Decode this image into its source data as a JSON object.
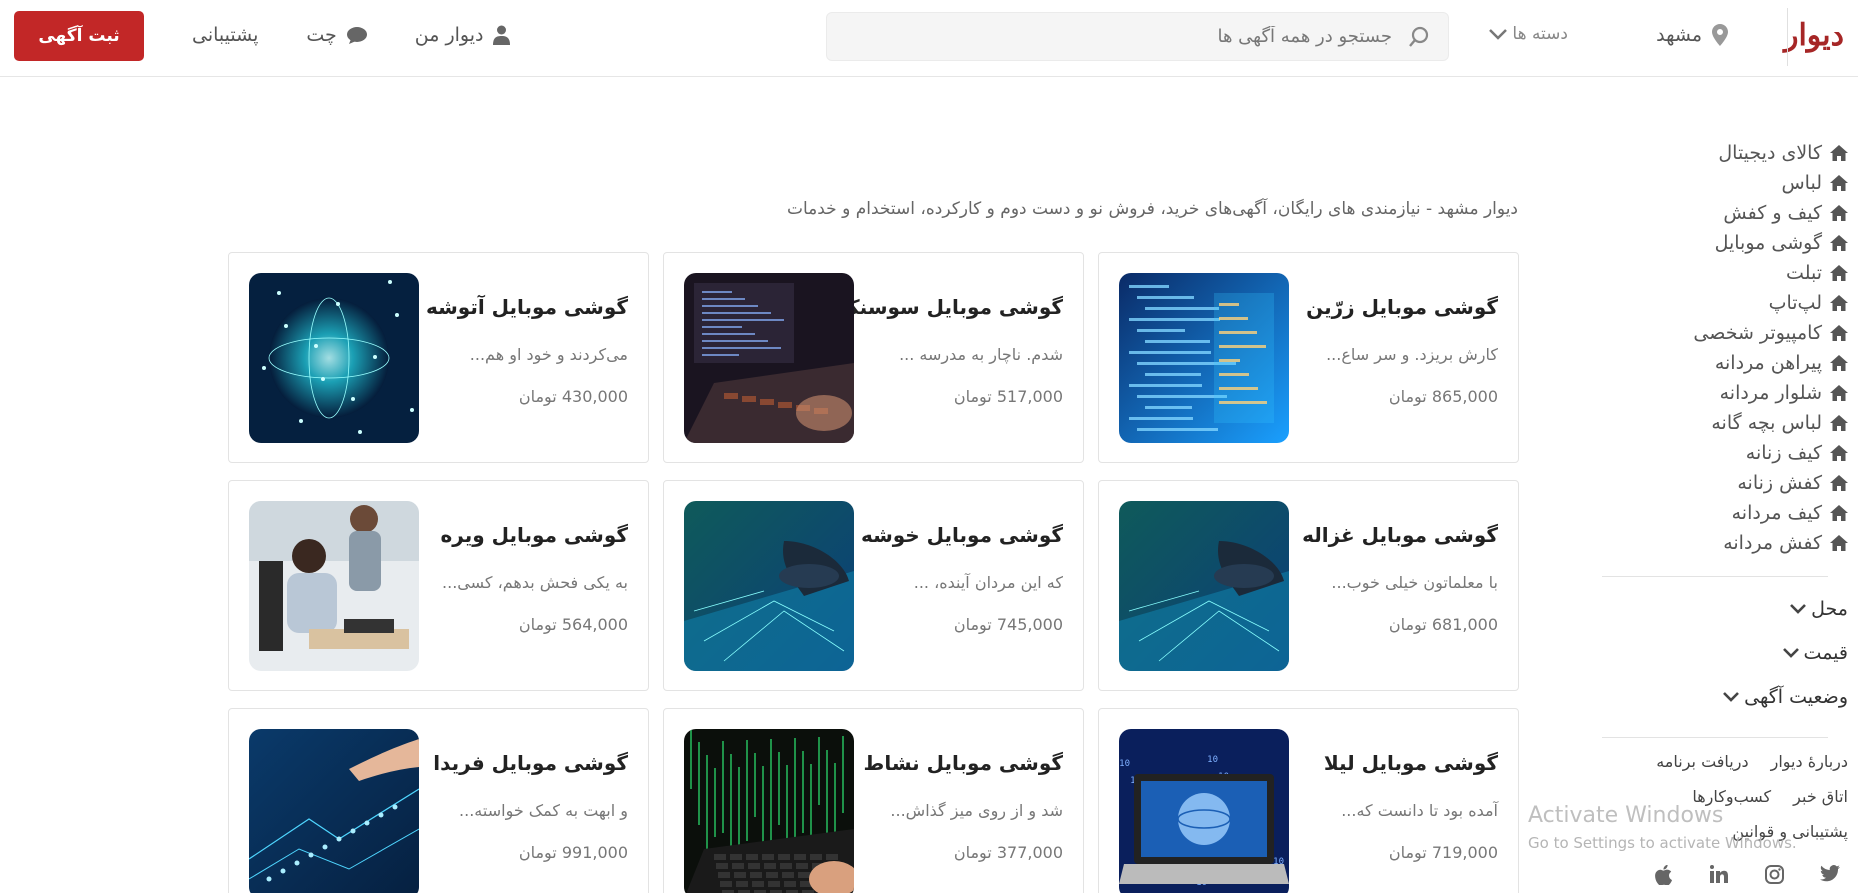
{
  "header": {
    "logo": "دیوار",
    "city": "مشهد",
    "categories_label": "دسته ها",
    "search_placeholder": "جستجو در همه آگهی ها",
    "nav": {
      "my_divar": "دیوار من",
      "chat": "چت",
      "support": "پشتیبانی"
    },
    "post_button": "ثبت آگهی"
  },
  "sidebar": {
    "categories": [
      "کالای دیجیتال",
      "لباس",
      "کیف و کفش",
      "گوشی موبایل",
      "تبلت",
      "لپ‌تاپ",
      "کامپیوتر شخصی",
      "پیراهن مردانه",
      "شلوار مردانه",
      "لباس بچه گانه",
      "کیف زنانه",
      "کفش زنانه",
      "کیف مردانه",
      "کفش مردانه"
    ],
    "filters": [
      "محل",
      "قیمت",
      "وضعیت آگهی"
    ],
    "footer_links": [
      "دربارهٔ دیوار",
      "دریافت برنامه",
      "اتاق خبر",
      "کسب‌وکارها",
      "پشتیبانی و قوانین"
    ],
    "social_icons": [
      "twitter-icon",
      "instagram-icon",
      "linkedin-icon",
      "apple-icon"
    ]
  },
  "main": {
    "description": "دیوار مشهد - نیازمندی های رایگان، آگهی‌های خرید، فروش نو و دست دوم و کارکرده، استخدام و خدمات",
    "listings": [
      {
        "title": "گوشی موبایل زرّین",
        "desc": "کارش بریزد. و سر ساع...",
        "price": "865,000 تومان",
        "image": "code-screen-blue"
      },
      {
        "title": "گوشی موبایل سوسنک",
        "desc": "شدم. ناچار به مدرسه ...",
        "price": "517,000 تومان",
        "image": "laptop-code-dark"
      },
      {
        "title": "گوشی موبایل آتوشه",
        "desc": "می‌کردند و خود او هم...",
        "price": "430,000 تومان",
        "image": "digital-globe-teal"
      },
      {
        "title": "گوشی موبایل غزاله",
        "desc": "با معلماتون خیلی خوب...",
        "price": "681,000 تومان",
        "image": "hand-laptop-network"
      },
      {
        "title": "گوشی موبایل خوشه",
        "desc": "که این مردان آینده، ...",
        "price": "745,000 تومان",
        "image": "hand-laptop-network"
      },
      {
        "title": "گوشی موبایل ویره",
        "desc": "به یکی فحش بدهم، کسی...",
        "price": "564,000 تومان",
        "image": "office-people"
      },
      {
        "title": "گوشی موبایل لیلا",
        "desc": "آمده بود تا دانست که...",
        "price": "719,000 تومان",
        "image": "laptop-globe-binary"
      },
      {
        "title": "گوشی موبایل نشاط",
        "desc": "شد و از روی میز گذاش...",
        "price": "377,000 تومان",
        "image": "laptop-matrix-green"
      },
      {
        "title": "گوشی موبایل فریدا",
        "desc": "و ابهت به کمک خواسته...",
        "price": "991,000 تومان",
        "image": "hand-circuit-blue"
      }
    ]
  },
  "watermark": {
    "line1": "Activate Windows",
    "line2": "Go to Settings to activate Windows."
  },
  "colors": {
    "brand": "#a62626",
    "post_button": "#c22727"
  }
}
